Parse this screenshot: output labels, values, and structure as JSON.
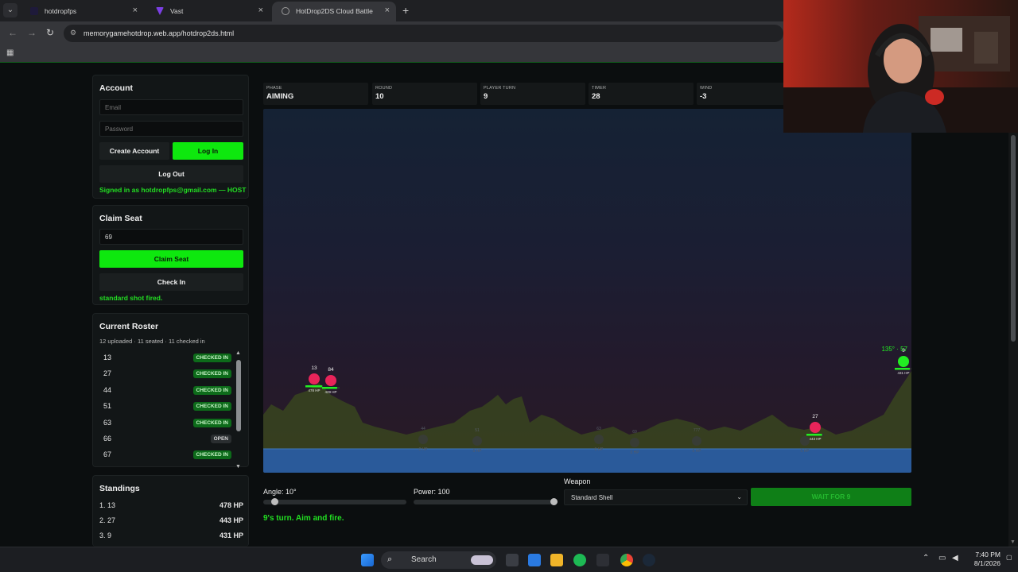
{
  "browser": {
    "tabs": [
      {
        "title": "hotdropfps",
        "color": "#1e1a3a"
      },
      {
        "title": "Vast",
        "color": "#7b3fe4"
      },
      {
        "title": "HotDrop2DS Cloud Battle",
        "color": "#5a5a5a"
      }
    ],
    "url": "memorygamehotdrop.web.app/hotdrop2ds.html"
  },
  "account": {
    "title": "Account",
    "email_placeholder": "Email",
    "password_placeholder": "Password",
    "create_label": "Create Account",
    "login_label": "Log In",
    "logout_label": "Log Out",
    "signed_in": "Signed in as hotdropfps@gmail.com — HOST"
  },
  "claim": {
    "title": "Claim Seat",
    "seat_value": "69",
    "claim_label": "Claim Seat",
    "checkin_label": "Check In",
    "status": "standard shot fired."
  },
  "roster": {
    "title": "Current Roster",
    "meta": "12 uploaded · 11 seated · 11 checked in",
    "rows": [
      {
        "seat": "13",
        "status": "CHECKED IN"
      },
      {
        "seat": "27",
        "status": "CHECKED IN"
      },
      {
        "seat": "44",
        "status": "CHECKED IN"
      },
      {
        "seat": "51",
        "status": "CHECKED IN"
      },
      {
        "seat": "63",
        "status": "CHECKED IN"
      },
      {
        "seat": "66",
        "status": "OPEN"
      },
      {
        "seat": "67",
        "status": "CHECKED IN"
      }
    ]
  },
  "standings": {
    "title": "Standings",
    "rows": [
      {
        "rank": "1. 13",
        "hp": "478 HP"
      },
      {
        "rank": "2. 27",
        "hp": "443 HP"
      },
      {
        "rank": "3. 9",
        "hp": "431 HP"
      }
    ]
  },
  "hud": [
    {
      "label": "PHASE",
      "value": "AIMING"
    },
    {
      "label": "ROUND",
      "value": "10"
    },
    {
      "label": "PLAYER TURN",
      "value": "9"
    },
    {
      "label": "TIMER",
      "value": "28"
    },
    {
      "label": "WIND",
      "value": "-3"
    }
  ],
  "arena": {
    "tanks": [
      {
        "seat": "13",
        "hp": "478 HP",
        "hp_fraction": 0.96,
        "color": "#e8245a"
      },
      {
        "seat": "84",
        "hp": "429 HP",
        "hp_fraction": 0.86,
        "color": "#e8245a"
      },
      {
        "seat": "27",
        "hp": "443 HP",
        "hp_fraction": 0.89,
        "color": "#e8245a"
      },
      {
        "seat": "9",
        "hp": "431 HP",
        "hp_fraction": 0.86,
        "color": "#22ee22"
      }
    ],
    "ghosts": [
      {
        "seat": "44",
        "hp": "0 HP"
      },
      {
        "seat": "51",
        "hp": "0 HP"
      },
      {
        "seat": "63",
        "hp": "0 HP"
      },
      {
        "seat": "69",
        "hp": "0 HP"
      },
      {
        "seat": "777",
        "hp": "0 HP"
      },
      {
        "seat": "",
        "hp": "0 HP"
      }
    ],
    "aim_readout": "135° · 57",
    "water_color": "#2a5a9a",
    "terrain_color": "#3d4a26"
  },
  "controls": {
    "angle_label": "Angle: 10°",
    "angle_value": 10,
    "power_label": "Power: 100",
    "power_value": 100,
    "weapon_label": "Weapon",
    "weapon_selected": "Standard Shell",
    "fire_label": "WAIT FOR 9",
    "turn_message": "9's turn. Aim and fire."
  },
  "taskbar": {
    "search_label": "Search",
    "time": "7:40 PM",
    "date": "8/1/2026"
  }
}
